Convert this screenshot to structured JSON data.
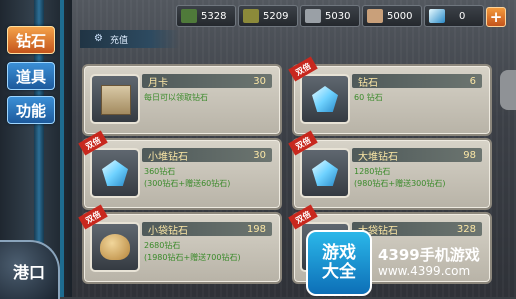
{
  "sidebar": {
    "tabs": [
      {
        "label": "钻石",
        "active": true
      },
      {
        "label": "道具",
        "active": false
      },
      {
        "label": "功能",
        "active": false
      }
    ],
    "port_label": "港口"
  },
  "topbar": {
    "resources": [
      {
        "icon": "fuel-icon",
        "value": "5328"
      },
      {
        "icon": "ammo-icon",
        "value": "5209"
      },
      {
        "icon": "steel-icon",
        "value": "5030"
      },
      {
        "icon": "bauxite-icon",
        "value": "5000"
      },
      {
        "icon": "diamond-icon",
        "value": "0"
      }
    ],
    "plus_label": "+"
  },
  "header": {
    "title": "充值"
  },
  "cards": [
    {
      "name": "月卡",
      "price": "30",
      "desc1": "每日可以领取钻石",
      "desc2": "",
      "tag": "",
      "thumb": "monthly-card-icon"
    },
    {
      "name": "钻石",
      "price": "6",
      "desc1": "60 钻石",
      "desc2": "",
      "tag": "双倍",
      "thumb": "diamond-icon"
    },
    {
      "name": "小堆钻石",
      "price": "30",
      "desc1": "360钻石",
      "desc2": "(300钻石+赠送60钻石)",
      "tag": "双倍",
      "thumb": "diamond-pile-small-icon"
    },
    {
      "name": "大堆钻石",
      "price": "98",
      "desc1": "1280钻石",
      "desc2": "(980钻石+赠送300钻石)",
      "tag": "双倍",
      "thumb": "diamond-pile-large-icon"
    },
    {
      "name": "小袋钻石",
      "price": "198",
      "desc1": "2680钻石",
      "desc2": "(1980钻石+赠送700钻石)",
      "tag": "双倍",
      "thumb": "diamond-bag-small-icon"
    },
    {
      "name": "大袋钻石",
      "price": "328",
      "desc1": "",
      "desc2": "",
      "tag": "双倍",
      "thumb": "diamond-bag-large-icon"
    }
  ],
  "watermark": {
    "badge": "游戏大全",
    "title": "4399手机游戏",
    "url": "www.4399.com"
  },
  "colors": {
    "accent_orange": "#c4541c",
    "accent_blue": "#1d5a9c",
    "desc_green": "#3a8a2a",
    "price_yellow": "#fbe7a6"
  }
}
